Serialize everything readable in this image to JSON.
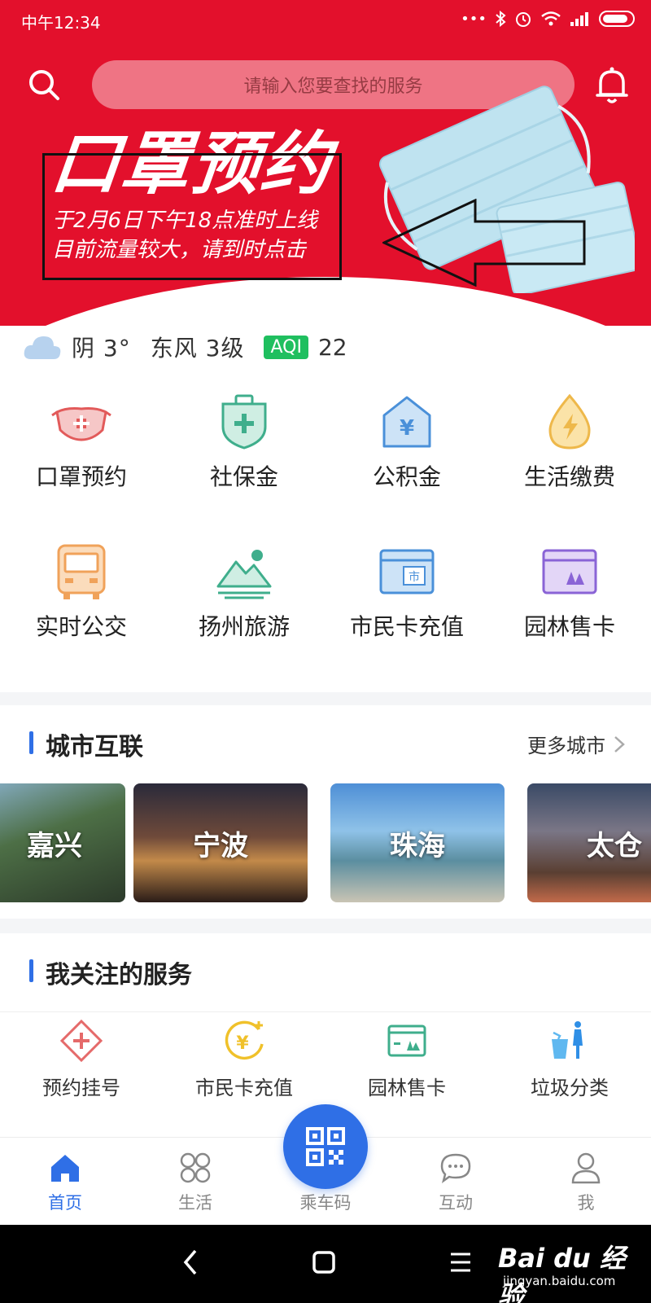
{
  "status_bar": {
    "time": "中午12:34",
    "icons": [
      "signal-dots-icon",
      "bluetooth-icon",
      "alarm-icon",
      "wifi-icon",
      "cell-signal-icon",
      "battery-icon"
    ]
  },
  "header": {
    "search_placeholder": "请输入您要查找的服务",
    "search_icon": "search-icon",
    "bell_icon": "bell-icon"
  },
  "banner": {
    "title": "口罩预约",
    "line1": "于2月6日下午18点准时上线",
    "line2": "目前流量较大，请到时点击"
  },
  "weather": {
    "condition": "阴",
    "temp": "3°",
    "wind": "东风 3级",
    "aqi_label": "AQI",
    "aqi_value": "22"
  },
  "quick_services": [
    {
      "label": "口罩预约",
      "icon": "mask-icon"
    },
    {
      "label": "社保金",
      "icon": "shield-plus-icon"
    },
    {
      "label": "公积金",
      "icon": "house-yen-icon"
    },
    {
      "label": "生活缴费",
      "icon": "drop-bolt-icon"
    },
    {
      "label": "实时公交",
      "icon": "bus-icon"
    },
    {
      "label": "扬州旅游",
      "icon": "mountain-icon"
    },
    {
      "label": "市民卡充值",
      "icon": "city-card-icon"
    },
    {
      "label": "园林售卡",
      "icon": "garden-card-icon"
    }
  ],
  "cities_section": {
    "title": "城市互联",
    "more": "更多城市",
    "cities": [
      "嘉兴",
      "宁波",
      "珠海",
      "太仓"
    ]
  },
  "services_section": {
    "title": "我关注的服务",
    "items": [
      {
        "label": "预约挂号",
        "icon": "medical-diamond-icon"
      },
      {
        "label": "市民卡充值",
        "icon": "yen-circle-icon"
      },
      {
        "label": "园林售卡",
        "icon": "garden-ticket-icon"
      },
      {
        "label": "垃圾分类",
        "icon": "trash-sort-icon"
      }
    ]
  },
  "tabbar": [
    {
      "label": "首页",
      "active": true
    },
    {
      "label": "生活",
      "active": false
    },
    {
      "label": "乘车码",
      "active": false
    },
    {
      "label": "互动",
      "active": false
    },
    {
      "label": "我",
      "active": false
    }
  ],
  "watermark": {
    "main": "Bai du 经验",
    "sub": "jingyan.baidu.com"
  },
  "colors": {
    "brand_red": "#e3102c",
    "accent_blue": "#2f6fe6",
    "aqi_green": "#1fbf5f"
  }
}
